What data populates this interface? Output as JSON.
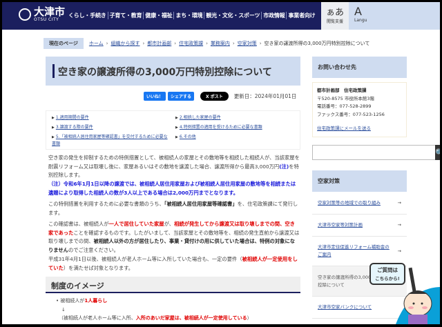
{
  "header": {
    "city_name": "大津市",
    "city_en": "OTSU CITY",
    "nav": [
      "くらし・手続き",
      "子育て・教育",
      "健康・福祉",
      "まち・環境",
      "観光・文化・スポーツ",
      "市政情報",
      "事業者向け"
    ],
    "accessibility": {
      "glyph": "ぁあ",
      "label": "閲覧支援"
    },
    "language": {
      "glyph": "A",
      "label": "Langu"
    }
  },
  "breadcrumb": {
    "current_label": "現在のページ",
    "links": [
      "ホーム",
      "組織から探す",
      "都市計画部",
      "住宅政策課",
      "業務案内",
      "空家対策"
    ],
    "current": "空き家の譲渡所得の3,000万円特別控除について"
  },
  "page": {
    "title": "空き家の譲渡所得の3,000万円特別控除について",
    "like": "いいね！",
    "share": "シェアする",
    "post": "X ポスト",
    "updated": "更新日：2024年01月01日"
  },
  "toc": [
    "1.適用期間の要件",
    "2.相続した家屋の要件",
    "3.譲渡する際の要件",
    "4.特例措置の適用を受けるために必要な書類",
    "5.「被相続人居住用家屋等確認書」を交付するために必要な書類",
    "6.その他"
  ],
  "body": {
    "p1a": "空き家の発生を抑制するための特例措置として、被相続人の家屋とその敷地等を相続した相続人が、当該家屋を耐震リフォーム又は取壊し後に、家屋あるいはその敷地を譲渡した場合、譲渡所得から最高3,000万円",
    "p1note": "(注)",
    "p1b": "を特別控除します。",
    "p2": "（注）令和6年1月1日以降の譲渡では、被相続人居住用家屋および被相続人居住用家屋の敷地等を相続または遺贈により取得した相続人の数が3人以上である場合は2,000万円までとなります。",
    "p3a": "この特例措置を利用するために必要な書類のうち、",
    "p3b": "「被相続人居住用家屋等確認書」",
    "p3c": "を、住宅政策課にて発行します。",
    "p4a": "この確認書は、被相続人が",
    "p4b": "一人で居住していた家屋",
    "p4c": "が、",
    "p4d": "相続が発生してから譲渡又は取り壊しまでの間、空き家であった",
    "p4e": "ことを確認するものです。したがいまして、当該家屋とその敷地等を、相続の発生直前から譲渡又は取り壊しまでの間、",
    "p4f": "被相続人以外の方が居住したり、事業・貸付けの用に供していた場合は、特例の対象になりません",
    "p4g": "のでご注意ください。",
    "p5a": "平成31年4月1日以後、被相続人が老人ホーム等に入所していた場合も、一定の要件（",
    "p5b": "被相続人が一定使用をしていた",
    "p5c": "）を満たせば対象となります。"
  },
  "section": {
    "heading": "制度のイメージ",
    "item1a": "被相続人が",
    "item1b": "1人暮らし",
    "arrow": "↓",
    "item2a": "（被相続人が老人ホーム等に入所、",
    "item2b": "入所のあいだ家屋は、被相続人が一定使用している",
    "item2c": "）"
  },
  "sidebar": {
    "contact_heading": "お問い合わせ先",
    "dept": "都市計画部　住宅政策課",
    "address": "〒520-8575 市役所本館3階",
    "tel": "電話番号：077-528-2899",
    "fax": "ファックス番号：077-523-1256",
    "mail_link": "住宅政策課にメールを送る",
    "search_placeholder": "",
    "section_heading": "空家対策",
    "items": [
      "空家対策等の地域での取り組み",
      "大津市空家等対策計画",
      "大津市定住促進リフォーム補助金のご案内",
      "空き家の譲渡所得の3,000万円特別控除について",
      "大津市空家バンクについて"
    ],
    "arrow": "→"
  },
  "mascot": {
    "line1": "ご質問は",
    "line2": "こちらから!"
  }
}
